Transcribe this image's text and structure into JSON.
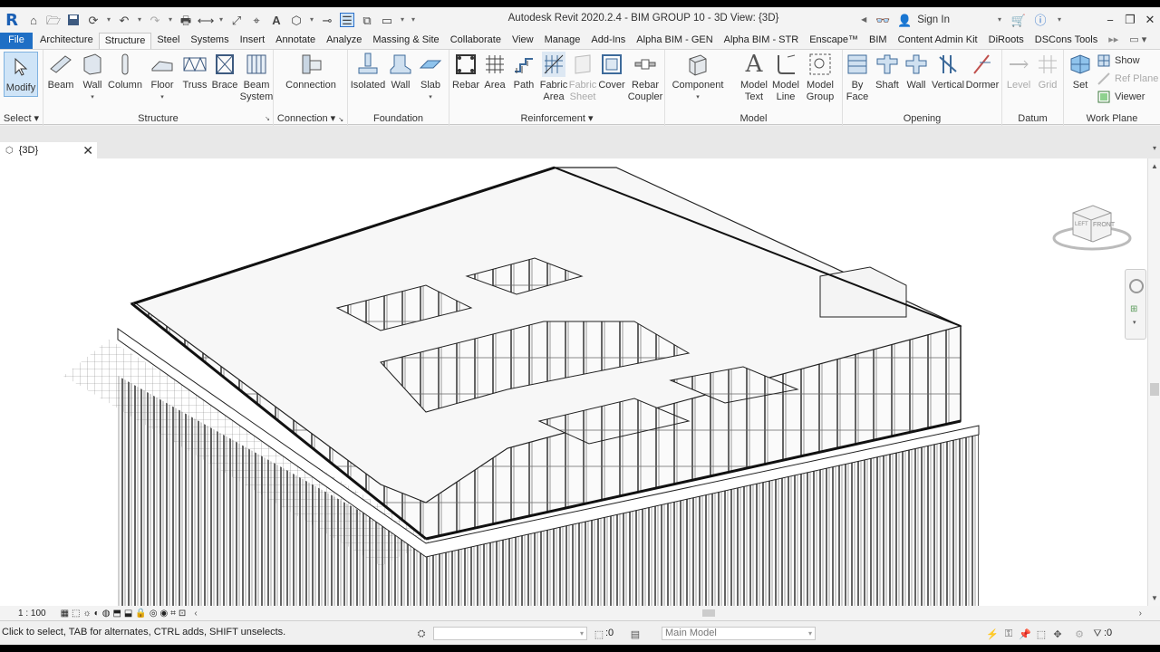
{
  "title_bar": {
    "title": "Autodesk Revit 2020.2.4 - BIM GROUP 10 - 3D View: {3D}",
    "sign_in": "Sign In",
    "logo": "R"
  },
  "tabs": [
    {
      "label": "File"
    },
    {
      "label": "Architecture"
    },
    {
      "label": "Structure"
    },
    {
      "label": "Steel"
    },
    {
      "label": "Systems"
    },
    {
      "label": "Insert"
    },
    {
      "label": "Annotate"
    },
    {
      "label": "Analyze"
    },
    {
      "label": "Massing & Site"
    },
    {
      "label": "Collaborate"
    },
    {
      "label": "View"
    },
    {
      "label": "Manage"
    },
    {
      "label": "Add-Ins"
    },
    {
      "label": "Alpha BIM - GEN"
    },
    {
      "label": "Alpha BIM - STR"
    },
    {
      "label": "Enscape™"
    },
    {
      "label": "BIM"
    },
    {
      "label": "Content Admin Kit"
    },
    {
      "label": "DiRoots"
    },
    {
      "label": "DSCons Tools"
    }
  ],
  "ribbon": {
    "select": {
      "title": "Select",
      "modify": "Modify"
    },
    "structure": {
      "title": "Structure",
      "beam": "Beam",
      "wall": "Wall",
      "column": "Column",
      "floor": "Floor",
      "truss": "Truss",
      "brace": "Brace",
      "beam_system_1": "Beam",
      "beam_system_2": "System"
    },
    "connection": {
      "title": "Connection",
      "connection": "Connection"
    },
    "foundation": {
      "title": "Foundation",
      "isolated": "Isolated",
      "wall": "Wall",
      "slab": "Slab"
    },
    "reinforcement": {
      "title": "Reinforcement",
      "rebar": "Rebar",
      "area": "Area",
      "path": "Path",
      "fabric_area_1": "Fabric",
      "fabric_area_2": "Area",
      "fabric_sheet_1": "Fabric",
      "fabric_sheet_2": "Sheet",
      "cover": "Cover",
      "rebar_coupler_1": "Rebar",
      "rebar_coupler_2": "Coupler"
    },
    "model": {
      "title": "Model",
      "component": "Component",
      "model_text_1": "Model",
      "model_text_2": "Text",
      "model_line_1": "Model",
      "model_line_2": "Line",
      "model_group_1": "Model",
      "model_group_2": "Group"
    },
    "opening": {
      "title": "Opening",
      "by_face_1": "By",
      "by_face_2": "Face",
      "shaft": "Shaft",
      "wall": "Wall",
      "vertical": "Vertical",
      "dormer": "Dormer"
    },
    "datum": {
      "title": "Datum",
      "level": "Level",
      "grid": "Grid"
    },
    "work_plane": {
      "title": "Work Plane",
      "set": "Set",
      "show": "Show",
      "ref_plane": "Ref  Plane",
      "viewer": "Viewer"
    }
  },
  "view_tab": {
    "label": "{3D}"
  },
  "viewcube": {
    "left": "LEFT",
    "front": "FRONT"
  },
  "view_control": {
    "scale": "1 : 100"
  },
  "status_bar": {
    "message": "Click to select, TAB for alternates, CTRL adds, SHIFT unselects.",
    "selection_count": ":0",
    "model_combo": "Main Model",
    "filter_count": ":0"
  },
  "colors": {
    "file_tab": "#1f6fc5",
    "accent_blue": "#2a6fc9"
  }
}
